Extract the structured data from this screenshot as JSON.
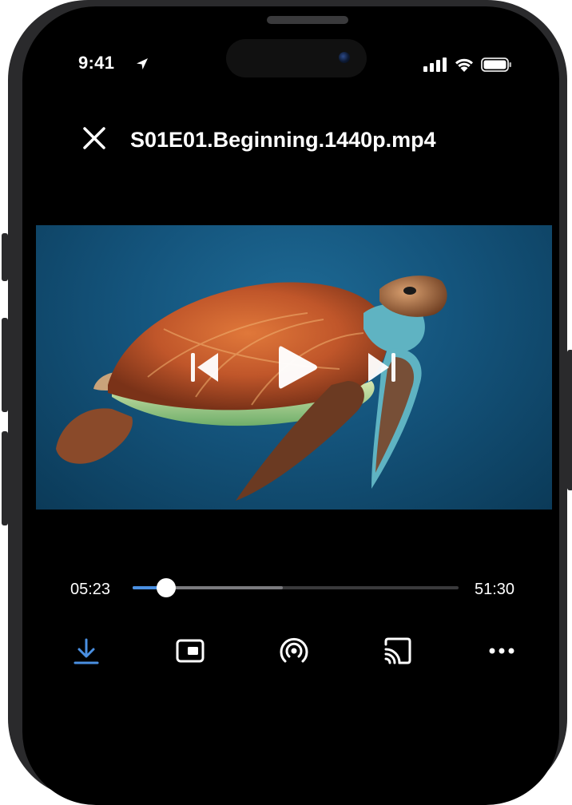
{
  "status_bar": {
    "time": "9:41"
  },
  "player": {
    "file_title": "S01E01.Beginning.1440p.mp4",
    "current_time": "05:23",
    "total_time": "51:30",
    "progress_fraction": 0.104,
    "buffered_fraction": 0.46
  },
  "toolbar": {
    "items": [
      {
        "icon": "download-icon"
      },
      {
        "icon": "picture-in-picture-icon"
      },
      {
        "icon": "airplay-broadcast-icon"
      },
      {
        "icon": "cast-icon"
      },
      {
        "icon": "more-icon"
      }
    ]
  },
  "colors": {
    "accent": "#4a90e2",
    "background": "#000000",
    "text": "#ffffff"
  }
}
